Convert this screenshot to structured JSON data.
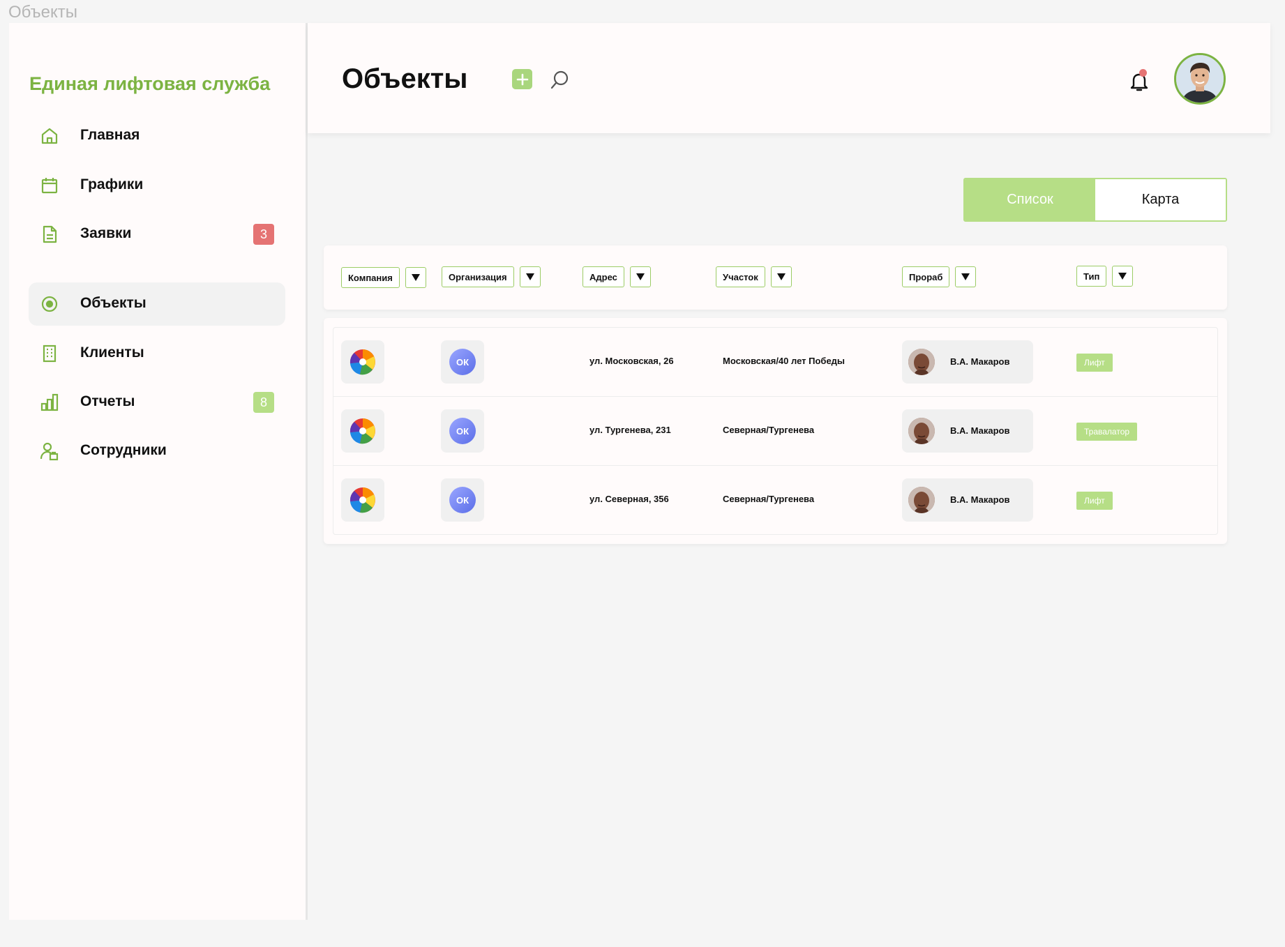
{
  "window": {
    "title": "Объекты"
  },
  "sidebar": {
    "brand": "Единая лифтовая служба",
    "items": [
      {
        "label": "Главная",
        "icon": "home-icon",
        "active": false,
        "badge": null
      },
      {
        "label": "Графики",
        "icon": "calendar-icon",
        "active": false,
        "badge": null
      },
      {
        "label": "Заявки",
        "icon": "document-icon",
        "active": false,
        "badge": "3",
        "badge_color": "#e57373"
      },
      {
        "label": "Объекты",
        "icon": "target-icon",
        "active": true,
        "badge": null
      },
      {
        "label": "Клиенты",
        "icon": "building-icon",
        "active": false,
        "badge": null
      },
      {
        "label": "Отчеты",
        "icon": "bar-chart-icon",
        "active": false,
        "badge": "8",
        "badge_color": "#b6de86"
      },
      {
        "label": "Сотрудники",
        "icon": "user-icon",
        "active": false,
        "badge": null
      }
    ]
  },
  "header": {
    "title": "Объекты",
    "add_icon": "plus-icon",
    "search_icon": "search-icon",
    "notification_icon": "bell-icon",
    "has_unread": true
  },
  "view_toggle": {
    "options": [
      {
        "label": "Список",
        "active": true
      },
      {
        "label": "Карта",
        "active": false
      }
    ]
  },
  "filters": [
    {
      "label": "Компания"
    },
    {
      "label": "Организация"
    },
    {
      "label": "Адрес"
    },
    {
      "label": "Участок"
    },
    {
      "label": "Прораб"
    },
    {
      "label": "Тип"
    }
  ],
  "rows": [
    {
      "org_logo": "ОК",
      "address": "ул. Московская, 26",
      "section": "Московская/40 лет Победы",
      "foreman": "В.А. Макаров",
      "type": "Лифт"
    },
    {
      "org_logo": "ОК",
      "address": "ул. Тургенева, 231",
      "section": "Северная/Тургенева",
      "foreman": "В.А. Макаров",
      "type": "Травалатор"
    },
    {
      "org_logo": "ОК",
      "address": "ул. Северная, 356",
      "section": "Северная/Тургенева",
      "foreman": "В.А. Макаров",
      "type": "Лифт"
    }
  ],
  "colors": {
    "accent": "#7cb342",
    "accent_light": "#b6de86",
    "badge_red": "#e57373",
    "background": "#f5f5f5"
  }
}
